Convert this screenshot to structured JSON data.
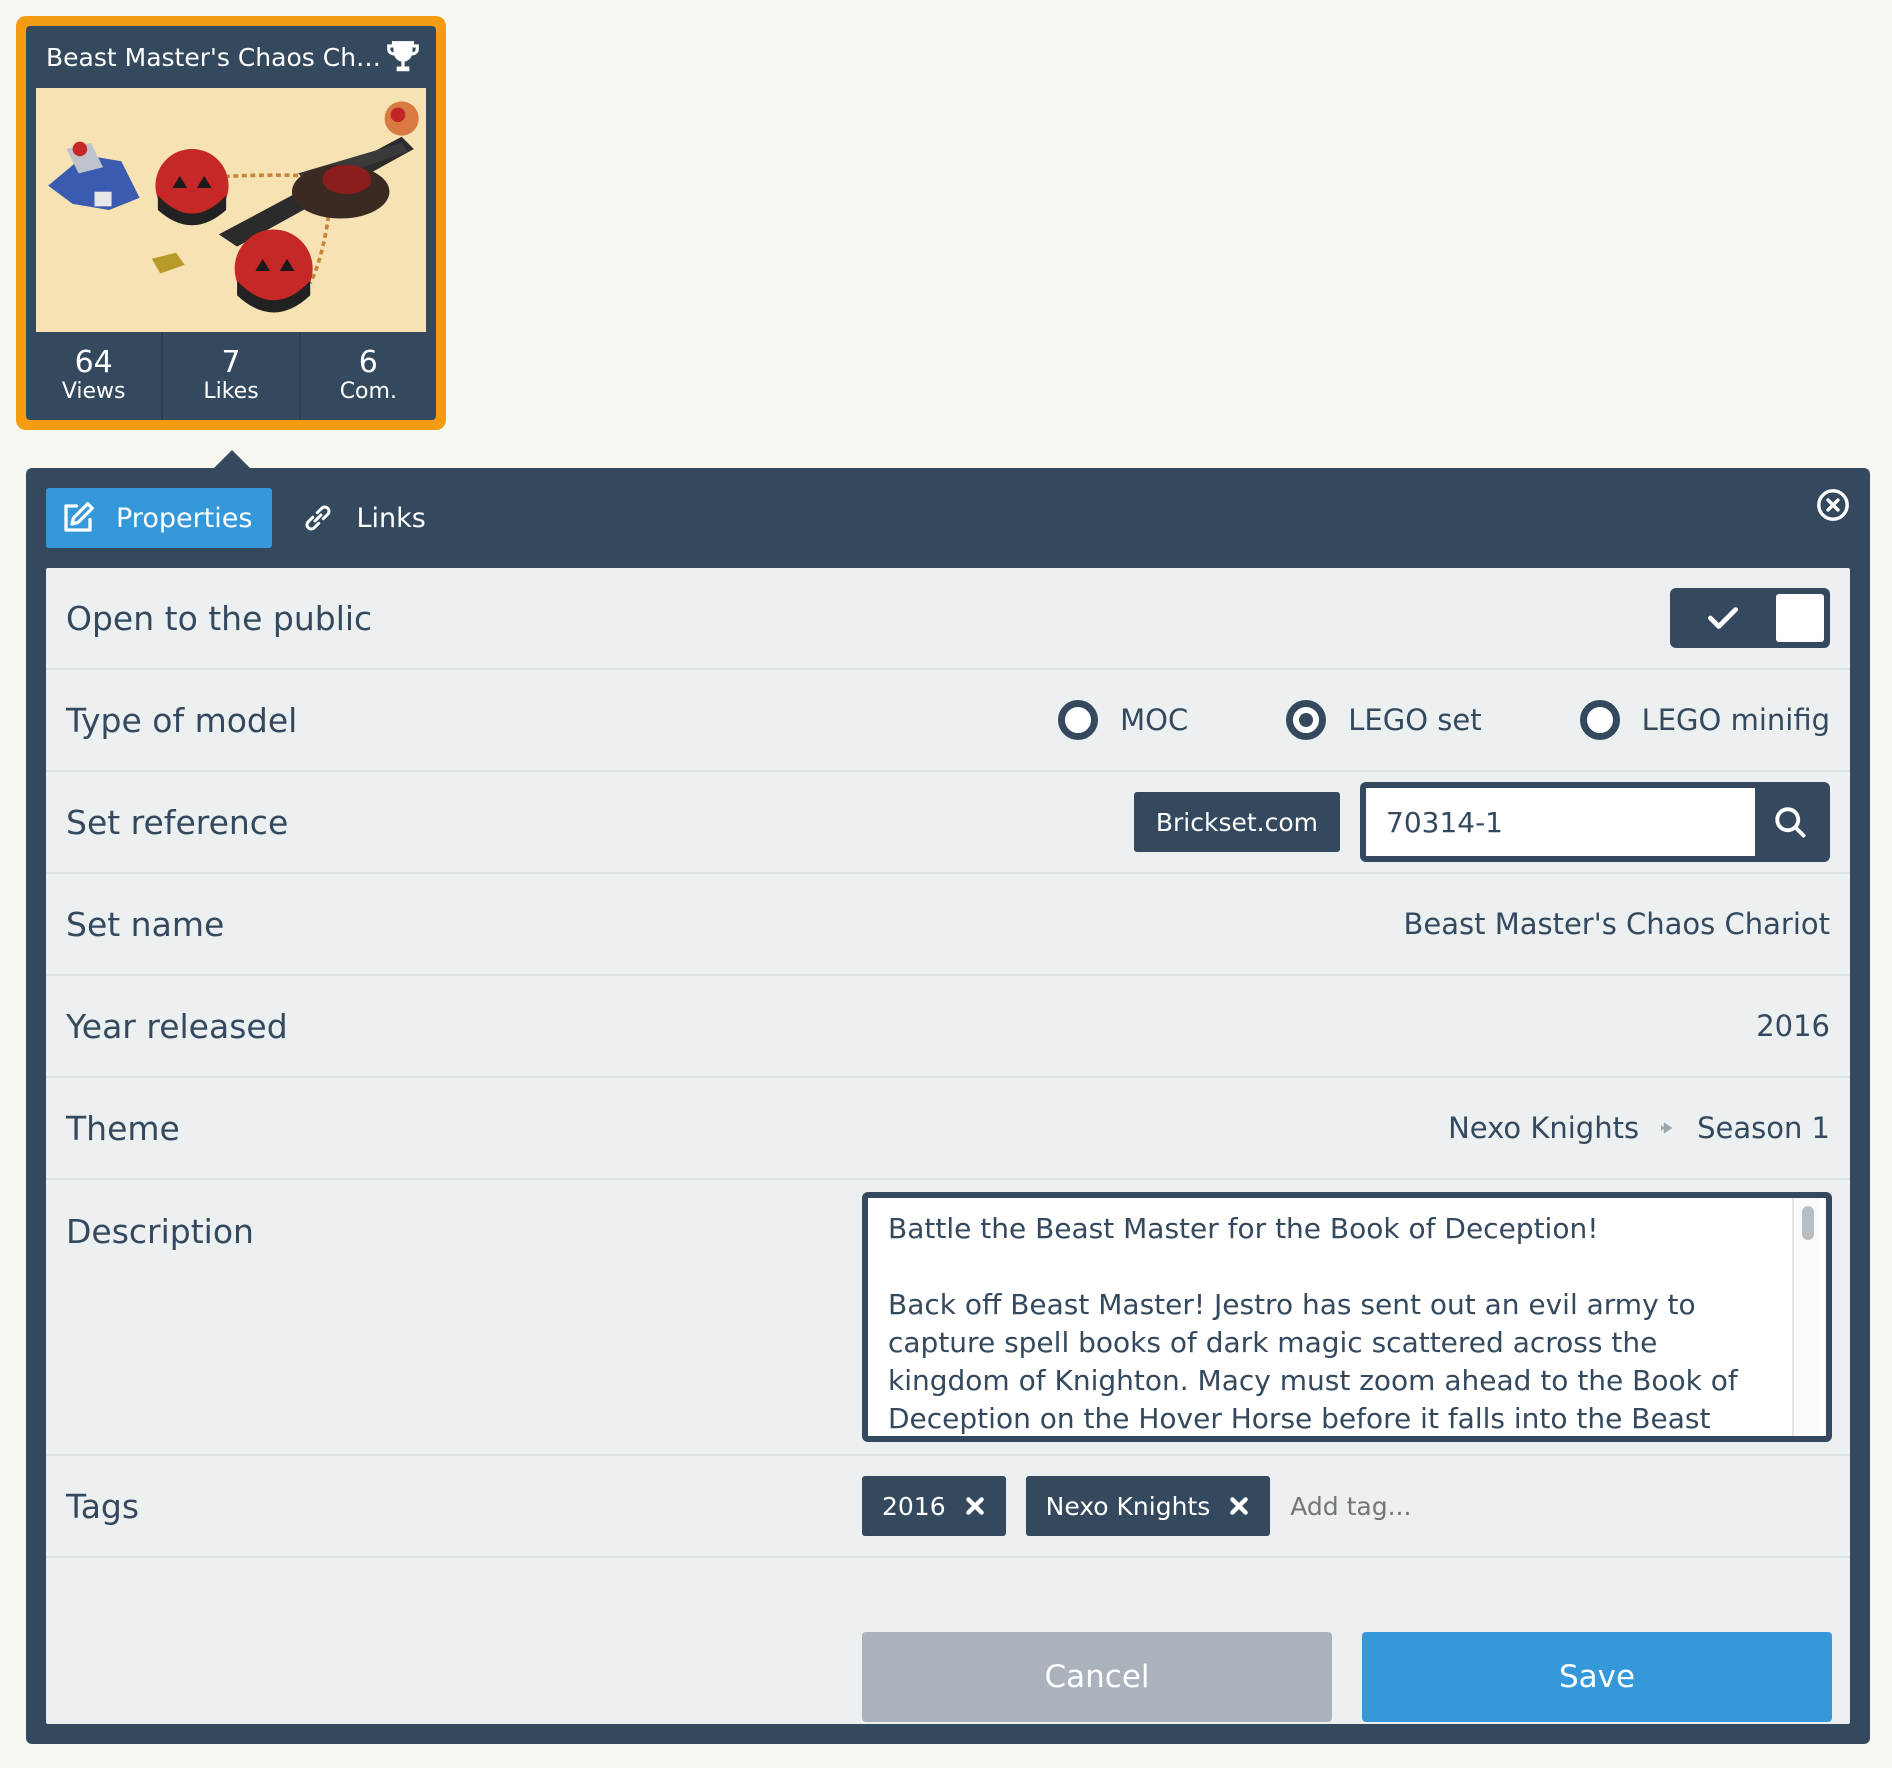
{
  "card": {
    "title": "Beast Master's Chaos Cha...",
    "stats": [
      {
        "value": "64",
        "label": "Views"
      },
      {
        "value": "7",
        "label": "Likes"
      },
      {
        "value": "6",
        "label": "Com."
      }
    ]
  },
  "tabs": [
    {
      "label": "Properties",
      "icon": "edit-icon",
      "active": true
    },
    {
      "label": "Links",
      "icon": "link-icon",
      "active": false
    }
  ],
  "fields": {
    "public": {
      "label": "Open to the public",
      "checked": true
    },
    "type": {
      "label": "Type of model",
      "options": [
        "MOC",
        "LEGO set",
        "LEGO minifig"
      ],
      "selected": "LEGO set"
    },
    "set_reference": {
      "label": "Set reference",
      "source_button": "Brickset.com",
      "value": "70314-1"
    },
    "set_name": {
      "label": "Set name",
      "value": "Beast Master's Chaos Chariot"
    },
    "year": {
      "label": "Year released",
      "value": "2016"
    },
    "theme": {
      "label": "Theme",
      "parts": [
        "Nexo Knights",
        "Season 1"
      ]
    },
    "description": {
      "label": "Description",
      "value": "Battle the Beast Master for the Book of Deception!\n\nBack off Beast Master! Jestro has sent out an evil army to capture spell books of dark magic scattered across the kingdom of Knighton. Macy must zoom ahead to the Book of Deception on the Hover Horse before it falls into the Beast Master’s hands! Watch out"
    },
    "tags": {
      "label": "Tags",
      "items": [
        "2016",
        "Nexo Knights"
      ],
      "placeholder": "Add tag..."
    }
  },
  "actions": {
    "cancel": "Cancel",
    "save": "Save"
  },
  "colors": {
    "accent": "#3498db",
    "dark": "#34495e",
    "card_border": "#f39c12",
    "cancel": "#aab2bb"
  }
}
